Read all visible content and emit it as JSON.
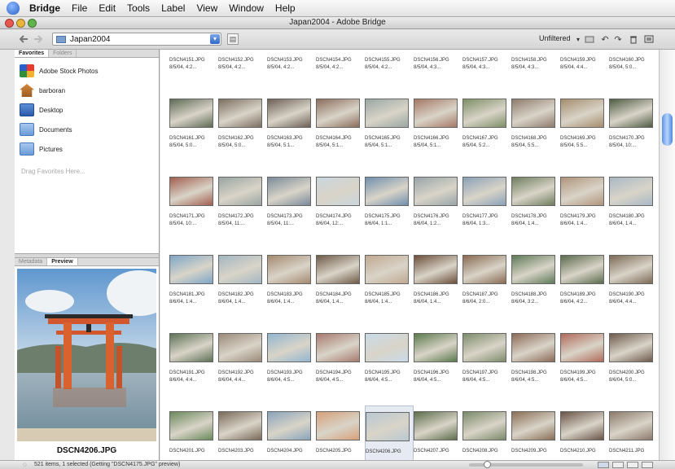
{
  "menubar": {
    "items": [
      "Bridge",
      "File",
      "Edit",
      "Tools",
      "Label",
      "View",
      "Window",
      "Help"
    ]
  },
  "window": {
    "title": "Japan2004 - Adobe Bridge"
  },
  "toolbar": {
    "path": "Japan2004",
    "filter_label": "Unfiltered"
  },
  "left_panel": {
    "tabs": [
      "Favorites",
      "Folders"
    ],
    "favorites": [
      {
        "label": "Adobe Stock Photos",
        "icon": "adobe-stock-icon"
      },
      {
        "label": "barboran",
        "icon": "home-icon"
      },
      {
        "label": "Desktop",
        "icon": "desktop-icon"
      },
      {
        "label": "Documents",
        "icon": "folder-icon"
      },
      {
        "label": "Pictures",
        "icon": "folder-icon"
      }
    ],
    "drag_hint": "Drag Favorites Here...",
    "bottom_tabs": [
      "Metadata",
      "Preview"
    ],
    "preview_name": "DSCN4206.JPG"
  },
  "content": {
    "rows": [
      {
        "names": [
          "DSCN4151.JPG",
          "DSCN4152.JPG",
          "DSCN4153.JPG",
          "DSCN4154.JPG",
          "DSCN4155.JPG",
          "DSCN4156.JPG",
          "DSCN4157.JPG",
          "DSCN4158.JPG",
          "DSCN4159.JPG",
          "DSCN4160.JPG"
        ],
        "dates": [
          "8/5/04, 4:2...",
          "8/5/04, 4:2...",
          "8/5/04, 4:2...",
          "8/5/04, 4:2...",
          "8/5/04, 4:2...",
          "8/5/04, 4:3...",
          "8/5/04, 4:3...",
          "8/5/04, 4:3...",
          "8/5/04, 4:4...",
          "8/5/04, 5:0..."
        ]
      },
      {
        "names": [
          "DSCN4161.JPG",
          "DSCN4162.JPG",
          "DSCN4163.JPG",
          "DSCN4164.JPG",
          "DSCN4165.JPG",
          "DSCN4166.JPG",
          "DSCN4167.JPG",
          "DSCN4168.JPG",
          "DSCN4169.JPG",
          "DSCN4170.JPG"
        ],
        "dates": [
          "8/5/04, 5:0...",
          "8/5/04, 5:0...",
          "8/5/04, 5:1...",
          "8/5/04, 5:1...",
          "8/5/04, 5:1...",
          "8/5/04, 5:1...",
          "8/5/04, 5:2...",
          "8/5/04, 5:5...",
          "8/5/04, 5:5...",
          "8/5/04, 10:..."
        ]
      },
      {
        "names": [
          "DSCN4171.JPG",
          "DSCN4172.JPG",
          "DSCN4173.JPG",
          "DSCN4174.JPG",
          "DSCN4175.JPG",
          "DSCN4176.JPG",
          "DSCN4177.JPG",
          "DSCN4178.JPG",
          "DSCN4179.JPG",
          "DSCN4180.JPG"
        ],
        "dates": [
          "8/5/04, 10:...",
          "8/5/04, 11:...",
          "8/5/04, 11:...",
          "8/6/04, 12:...",
          "8/6/04, 1:1...",
          "8/6/04, 1:2...",
          "8/6/04, 1:3...",
          "8/6/04, 1:4...",
          "8/6/04, 1:4...",
          "8/6/04, 1:4..."
        ]
      },
      {
        "names": [
          "DSCN4181.JPG",
          "DSCN4182.JPG",
          "DSCN4183.JPG",
          "DSCN4184.JPG",
          "DSCN4185.JPG",
          "DSCN4186.JPG",
          "DSCN4187.JPG",
          "DSCN4188.JPG",
          "DSCN4189.JPG",
          "DSCN4190.JPG"
        ],
        "dates": [
          "8/6/04, 1:4...",
          "8/6/04, 1:4...",
          "8/6/04, 1:4...",
          "8/6/04, 1:4...",
          "8/6/04, 1:4...",
          "8/6/04, 1:4...",
          "8/6/04, 2:0...",
          "8/6/04, 3:2...",
          "8/6/04, 4:2...",
          "8/6/04, 4:4..."
        ]
      },
      {
        "names": [
          "DSCN4191.JPG",
          "DSCN4192.JPG",
          "DSCN4193.JPG",
          "DSCN4194.JPG",
          "DSCN4195.JPG",
          "DSCN4196.JPG",
          "DSCN4197.JPG",
          "DSCN4198.JPG",
          "DSCN4199.JPG",
          "DSCN4200.JPG"
        ],
        "dates": [
          "8/6/04, 4:4...",
          "8/6/04, 4:4...",
          "8/6/04, 4:5...",
          "8/6/04, 4:5...",
          "8/6/04, 4:5...",
          "8/6/04, 4:5...",
          "8/6/04, 4:5...",
          "8/6/04, 4:5...",
          "8/6/04, 4:5...",
          "8/6/04, 5:0..."
        ]
      },
      {
        "names": [
          "DSCN4201.JPG",
          "DSCN4203.JPG",
          "DSCN4204.JPG",
          "DSCN4205.JPG",
          "DSCN4206.JPG",
          "DSCN4207.JPG",
          "DSCN4208.JPG",
          "DSCN4209.JPG",
          "DSCN4210.JPG",
          "DSCN4211.JPG"
        ],
        "dates": [
          "",
          "",
          "",
          "",
          "",
          "",
          "",
          "",
          "",
          ""
        ]
      }
    ],
    "row_palettes": [
      [
        "#8a7a62",
        "#6f8a9c",
        "#5d7a4c",
        "#7c8f6a",
        "#a08868",
        "#8c6e52",
        "#4f7399",
        "#7aa0b8",
        "#b39178",
        "#6b5a48"
      ],
      [
        "#5e6a55",
        "#7c6e60",
        "#6d5f55",
        "#8b6d5c",
        "#9aa7a3",
        "#a57865",
        "#7d8f66",
        "#8e7b6e",
        "#a58d6d",
        "#4f5c44"
      ],
      [
        "#a25e4e",
        "#9aa5a2",
        "#7a8b9a",
        "#c9d6dd",
        "#6f8fad",
        "#98a5a9",
        "#8aa1b8",
        "#6e7e5e",
        "#b0947c",
        "#a8b8c6"
      ],
      [
        "#7ea6c8",
        "#a3b6c2",
        "#a58a70",
        "#6e5a48",
        "#c0a891",
        "#6c4e3a",
        "#8a6a52",
        "#5e7a58",
        "#5a6a4c",
        "#7c6a56"
      ],
      [
        "#5d7256",
        "#9a8a7a",
        "#93b6d0",
        "#a77a70",
        "#c8dbe8",
        "#5a7a4c",
        "#7e8c6c",
        "#8c6a58",
        "#b06a5a",
        "#6d5a4c"
      ],
      [
        "#6a8a5c",
        "#7a6a5a",
        "#8aa4bc",
        "#d6a07a",
        "#b8c8d2",
        "#5d6e4c",
        "#7a8a6a",
        "#8a6e56",
        "#6a5448",
        "#8c7a6c"
      ]
    ],
    "selected": "DSCN4206.JPG"
  },
  "status": {
    "text": "521 items, 1 selected (Getting \"DSCN4175.JPG\" preview)"
  },
  "colors": {
    "selection": "#e6eaf2",
    "scroll_thumb": "#5a93e8",
    "window_bg": "#e8e8e8"
  }
}
